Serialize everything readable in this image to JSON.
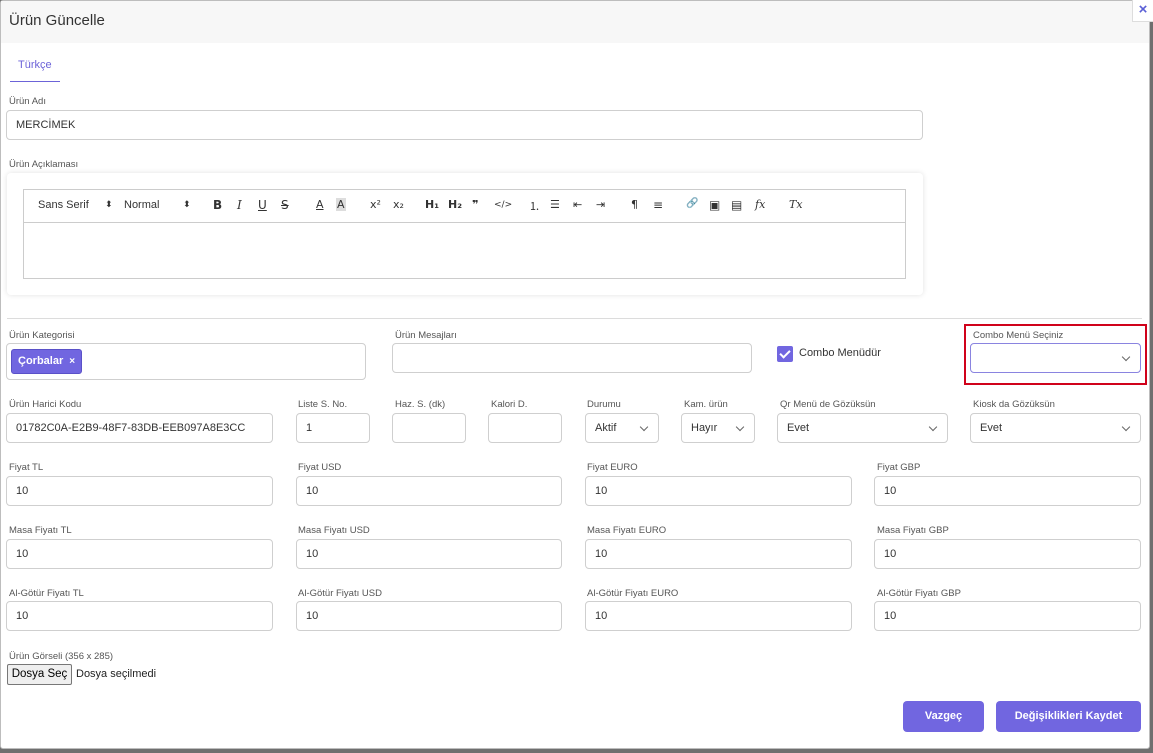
{
  "modal": {
    "title": "Ürün Güncelle",
    "close": "×"
  },
  "tab": {
    "label": "Türkçe"
  },
  "product_name": {
    "label": "Ürün Adı",
    "value": "MERCİMEK"
  },
  "description": {
    "label": "Ürün Açıklaması",
    "toolbar": {
      "font": "Sans Serif",
      "size": "Normal",
      "bold": "B",
      "italic": "I",
      "underline": "U",
      "strike": "S",
      "color": "A",
      "background": "A",
      "superscript": "x²",
      "subscript": "x₂",
      "h1": "H₁",
      "h2": "H₂",
      "blockquote": "❞",
      "code": "</>",
      "ordered_list": "⒈",
      "bullet_list": "☰",
      "outdent": "⇤",
      "indent": "⇥",
      "direction": "¶",
      "align": "≡",
      "link": "🔗",
      "image": "▣",
      "video": "▤",
      "formula": "fx",
      "clean": "Tx"
    }
  },
  "category": {
    "label": "Ürün Kategorisi",
    "chip": "Çorbalar",
    "remove": "×"
  },
  "messages": {
    "label": "Ürün Mesajları",
    "value": ""
  },
  "combo_menu": {
    "checkbox_label": "Combo Menüdür",
    "checked": true
  },
  "combo_select": {
    "label": "Combo Menü Seçiniz",
    "value": ""
  },
  "row2": {
    "external_code": {
      "label": "Ürün Harici Kodu",
      "value": "01782C0A-E2B9-48F7-83DB-EEB097A8E3CC"
    },
    "list_no": {
      "label": "Liste S. No.",
      "value": "1"
    },
    "prep_time": {
      "label": "Haz. S. (dk)",
      "value": ""
    },
    "calorie": {
      "label": "Kalori D.",
      "value": ""
    },
    "status": {
      "label": "Durumu",
      "value": "Aktif"
    },
    "campaign": {
      "label": "Kam. ürün",
      "value": "Hayır"
    },
    "qr_menu": {
      "label": "Qr Menü de Gözüksün",
      "value": "Evet"
    },
    "kiosk": {
      "label": "Kiosk da Gözüksün",
      "value": "Evet"
    }
  },
  "prices": {
    "tl": {
      "label": "Fiyat TL",
      "value": "10"
    },
    "usd": {
      "label": "Fiyat USD",
      "value": "10"
    },
    "euro": {
      "label": "Fiyat EURO",
      "value": "10"
    },
    "gbp": {
      "label": "Fiyat GBP",
      "value": "10"
    }
  },
  "table_prices": {
    "tl": {
      "label": "Masa Fiyatı TL",
      "value": "10"
    },
    "usd": {
      "label": "Masa Fiyatı USD",
      "value": "10"
    },
    "euro": {
      "label": "Masa Fiyatı EURO",
      "value": "10"
    },
    "gbp": {
      "label": "Masa Fiyatı GBP",
      "value": "10"
    }
  },
  "takeaway_prices": {
    "tl": {
      "label": "Al-Götür Fiyatı TL",
      "value": "10"
    },
    "usd": {
      "label": "Al-Götür Fiyatı USD",
      "value": "10"
    },
    "euro": {
      "label": "Al-Götür Fiyatı EURO",
      "value": "10"
    },
    "gbp": {
      "label": "Al-Götür Fiyatı GBP",
      "value": "10"
    }
  },
  "image": {
    "label": "Ürün Görseli (356 x 285)",
    "button": "Dosya Seç",
    "status": "Dosya seçilmedi"
  },
  "buttons": {
    "cancel": "Vazgeç",
    "save": "Değişiklikleri Kaydet"
  },
  "colors": {
    "accent": "#7166e0",
    "highlight": "#d0021b"
  }
}
